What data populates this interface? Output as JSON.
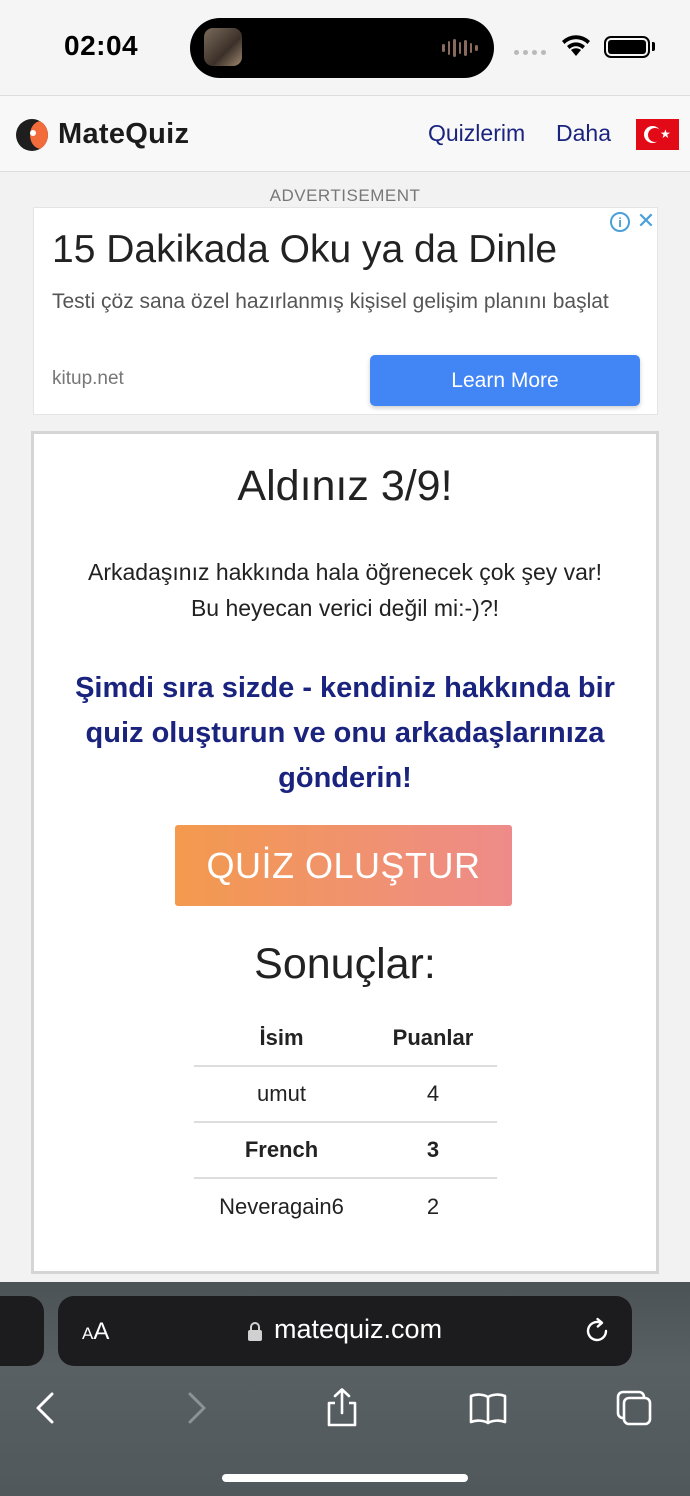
{
  "status_bar": {
    "time": "02:04"
  },
  "header": {
    "logo_text": "MateQuiz",
    "nav": {
      "quizlerim": "Quizlerim",
      "daha": "Daha"
    },
    "flag": "turkey-flag"
  },
  "ad": {
    "label": "ADVERTISEMENT",
    "title": "15 Dakikada Oku ya da Dinle",
    "description": "Testi çöz sana özel hazırlanmış kişisel gelişim planını başlat",
    "domain": "kitup.net",
    "cta": "Learn More",
    "info_symbol": "i",
    "close_symbol": "✕"
  },
  "result": {
    "score_title": "Aldınız 3/9!",
    "score_text": "Arkadaşınız hakkında hala öğrenecek çok şey var! Bu heyecan verici değil mi:-)?!",
    "cta_heading": "Şimdi sıra sizde - kendiniz hakkında bir quiz oluşturun ve onu arkadaşlarınıza gönderin!",
    "create_button": "QUİZ OLUŞTUR",
    "results_title": "Sonuçlar:",
    "table": {
      "headers": {
        "name": "İsim",
        "score": "Puanlar"
      },
      "rows": [
        {
          "name": "umut",
          "score": "4"
        },
        {
          "name": "French",
          "score": "3"
        },
        {
          "name": "Neveragain6",
          "score": "2"
        }
      ]
    }
  },
  "browser": {
    "aa_label_small": "A",
    "aa_label_large": "A",
    "url": "matequiz.com"
  },
  "colors": {
    "nav_link": "#1a237e",
    "cta_heading": "#1a237e",
    "button_gradient_start": "#f39a4e",
    "button_gradient_end": "#ee8b8a",
    "ad_cta": "#4285f4"
  }
}
